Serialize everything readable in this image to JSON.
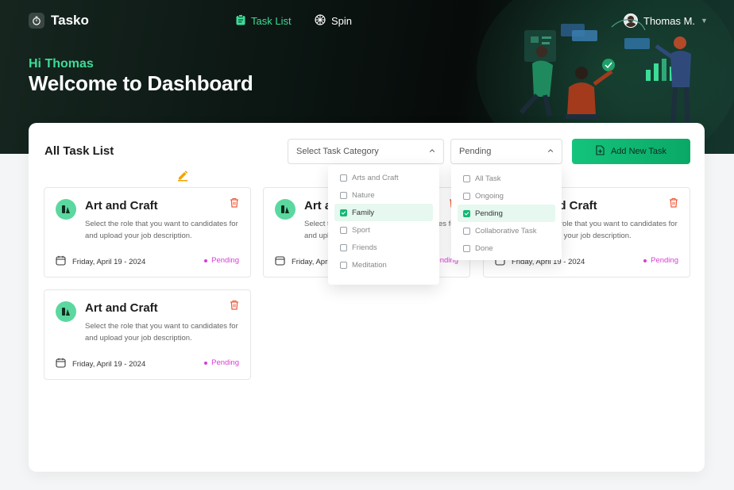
{
  "app": {
    "name": "Tasko"
  },
  "nav": {
    "task_list": "Task List",
    "spin": "Spin"
  },
  "user": {
    "name": "Thomas M."
  },
  "hero": {
    "greeting": "Hi Thomas",
    "title": "Welcome to Dashboard"
  },
  "panel": {
    "title": "All Task List"
  },
  "filters": {
    "category_placeholder": "Select Task Category",
    "status_value": "Pending",
    "add_button": "Add New Task"
  },
  "category_options": [
    {
      "label": "Arts and Craft",
      "checked": false
    },
    {
      "label": "Nature",
      "checked": false
    },
    {
      "label": "Family",
      "checked": true
    },
    {
      "label": "Sport",
      "checked": false
    },
    {
      "label": "Friends",
      "checked": false
    },
    {
      "label": "Meditation",
      "checked": false
    }
  ],
  "status_options": [
    {
      "label": "All Task",
      "checked": false
    },
    {
      "label": "Ongoing",
      "checked": false
    },
    {
      "label": "Pending",
      "checked": true
    },
    {
      "label": "Collaborative Task",
      "checked": false
    },
    {
      "label": "Done",
      "checked": false
    }
  ],
  "tasks": [
    {
      "title": "Art and Craft",
      "description": "Select the role that you want to candidates for and upload your job description.",
      "date": "Friday, April 19 - 2024",
      "status": "Pending"
    },
    {
      "title": "Art and Craft",
      "description": "Select the role that you want to candidates for and upload your job description.",
      "date": "Friday, April 19 - 2024",
      "status": "Pending"
    },
    {
      "title": "Art and Craft",
      "description": "Select the role that you want to candidates for and upload your job description.",
      "date": "Friday, April 19 - 2024",
      "status": "Pending"
    },
    {
      "title": "Art and Craft",
      "description": "Select the role that you want to candidates for and upload your job description.",
      "date": "Friday, April 19 - 2024",
      "status": "Pending"
    }
  ],
  "colors": {
    "accent": "#3ddc97",
    "button": "#14c47c",
    "status_pending": "#d63fd4",
    "delete": "#f05a3a"
  },
  "icons": {
    "logo": "stopwatch-icon",
    "task_list": "clipboard-icon",
    "spin": "wheel-icon",
    "card": "category-icon",
    "delete": "trash-icon",
    "date": "calendar-icon",
    "add": "add-file-icon",
    "edit": "pencil-icon"
  }
}
